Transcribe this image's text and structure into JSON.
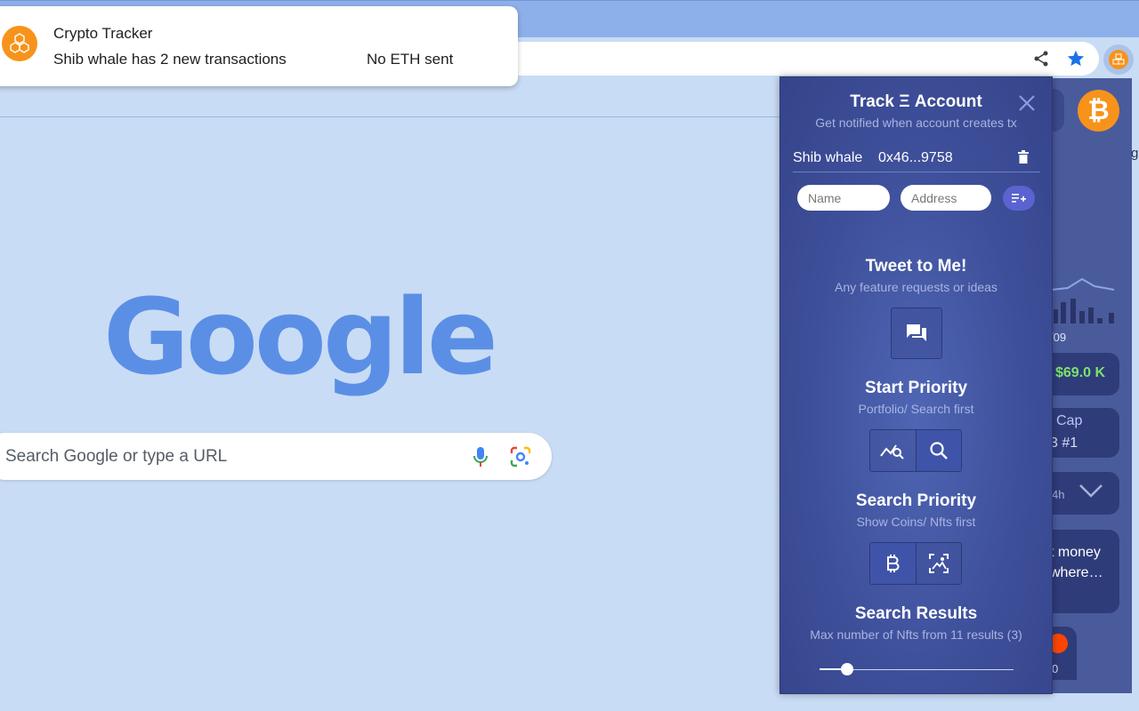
{
  "notification": {
    "title": "Crypto Tracker",
    "message": "Shib whale has 2 new transactions",
    "detail": "No ETH sent"
  },
  "google": {
    "logo_text": "Google",
    "search_placeholder": "Search Google or type a URL"
  },
  "popup": {
    "track_title": "Track Ξ Account",
    "track_subtitle": "Get notified when account creates tx",
    "account": {
      "name": "Shib whale",
      "address": "0x46...9758"
    },
    "name_placeholder": "Name",
    "address_placeholder": "Address",
    "tweet_title": "Tweet to Me!",
    "tweet_subtitle": "Any feature requests or ideas",
    "start_title": "Start Priority",
    "start_subtitle": "Portfolio/ Search first",
    "start_selected": "search",
    "search_title": "Search Priority",
    "search_subtitle": "Show Coins/ Nfts first",
    "search_selected": "coins",
    "results_title": "Search Results",
    "results_subtitle": "Max number of Nfts from 11 results (3)",
    "results_slider_fraction": 0.14
  },
  "background_popup": {
    "date_label": "/09",
    "price": "$69.0 K",
    "cap_label": "Cap",
    "cap_rank": "3 #1",
    "period": "4h",
    "news_text": "t money\nwhere…",
    "reddit_count": "0",
    "edge_char": "g"
  },
  "colors": {
    "accent_bitcoin": "#f7931a",
    "popup_bg": "#3e4f9a",
    "price_green": "#7be36b",
    "star_blue": "#1a73e8"
  }
}
